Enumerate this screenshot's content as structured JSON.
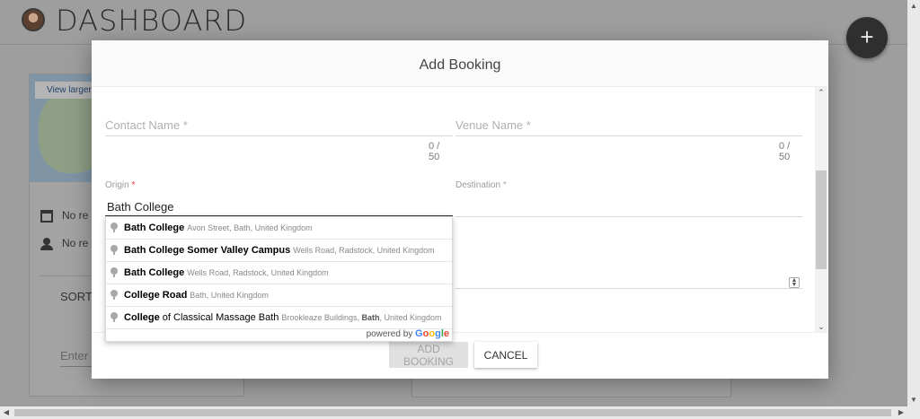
{
  "app": {
    "title": "DASHBOARD",
    "fab_label": "+"
  },
  "background": {
    "map": {
      "view_larger": "View larger"
    },
    "rows": [
      {
        "text": "No re",
        "icon": "calendar-icon"
      },
      {
        "text": "No re",
        "icon": "person-icon"
      }
    ],
    "sort_label": "SORT",
    "enter_placeholder": "Enter S"
  },
  "modal": {
    "title": "Add Booking",
    "contact": {
      "label": "Contact Name",
      "required": "*",
      "counter": "0 / 50"
    },
    "venue": {
      "label": "Venue Name",
      "required": "*",
      "counter": "0 / 50"
    },
    "origin": {
      "label": "Origin",
      "required": "*",
      "value": "Bath College"
    },
    "destination": {
      "label": "Destination",
      "required": "*"
    },
    "buttons": {
      "add": "ADD BOOKING",
      "cancel": "CANCEL"
    }
  },
  "autocomplete": {
    "items": [
      {
        "main_bold": "Bath College",
        "main_rest": "",
        "secondary_pre": "Avon Street, Bath, United Kingdom",
        "secondary_bold": "",
        "secondary_post": ""
      },
      {
        "main_bold": "Bath College",
        "main_rest": " Somer Valley Campus",
        "secondary_pre": "Wells Road, Radstock, United Kingdom",
        "secondary_bold": "",
        "secondary_post": ""
      },
      {
        "main_bold": "Bath College",
        "main_rest": "",
        "secondary_pre": "Wells Road, Radstock, United Kingdom",
        "secondary_bold": "",
        "secondary_post": ""
      },
      {
        "main_bold": "College",
        "main_rest": " Road",
        "secondary_pre": "Bath, United Kingdom",
        "secondary_bold": "",
        "secondary_post": ""
      },
      {
        "main_bold": "College",
        "main_rest": " of Classical Massage Bath",
        "secondary_pre": "Brookleaze Buildings, ",
        "secondary_bold": "Bath",
        "secondary_post": ", United Kingdom"
      }
    ],
    "powered_by": "powered by",
    "google": "Google"
  },
  "colors": {
    "accent_required": "#e53935",
    "google_blue": "#4285F4",
    "google_red": "#EA4335",
    "google_yellow": "#FBBC05",
    "google_green": "#34A853"
  }
}
